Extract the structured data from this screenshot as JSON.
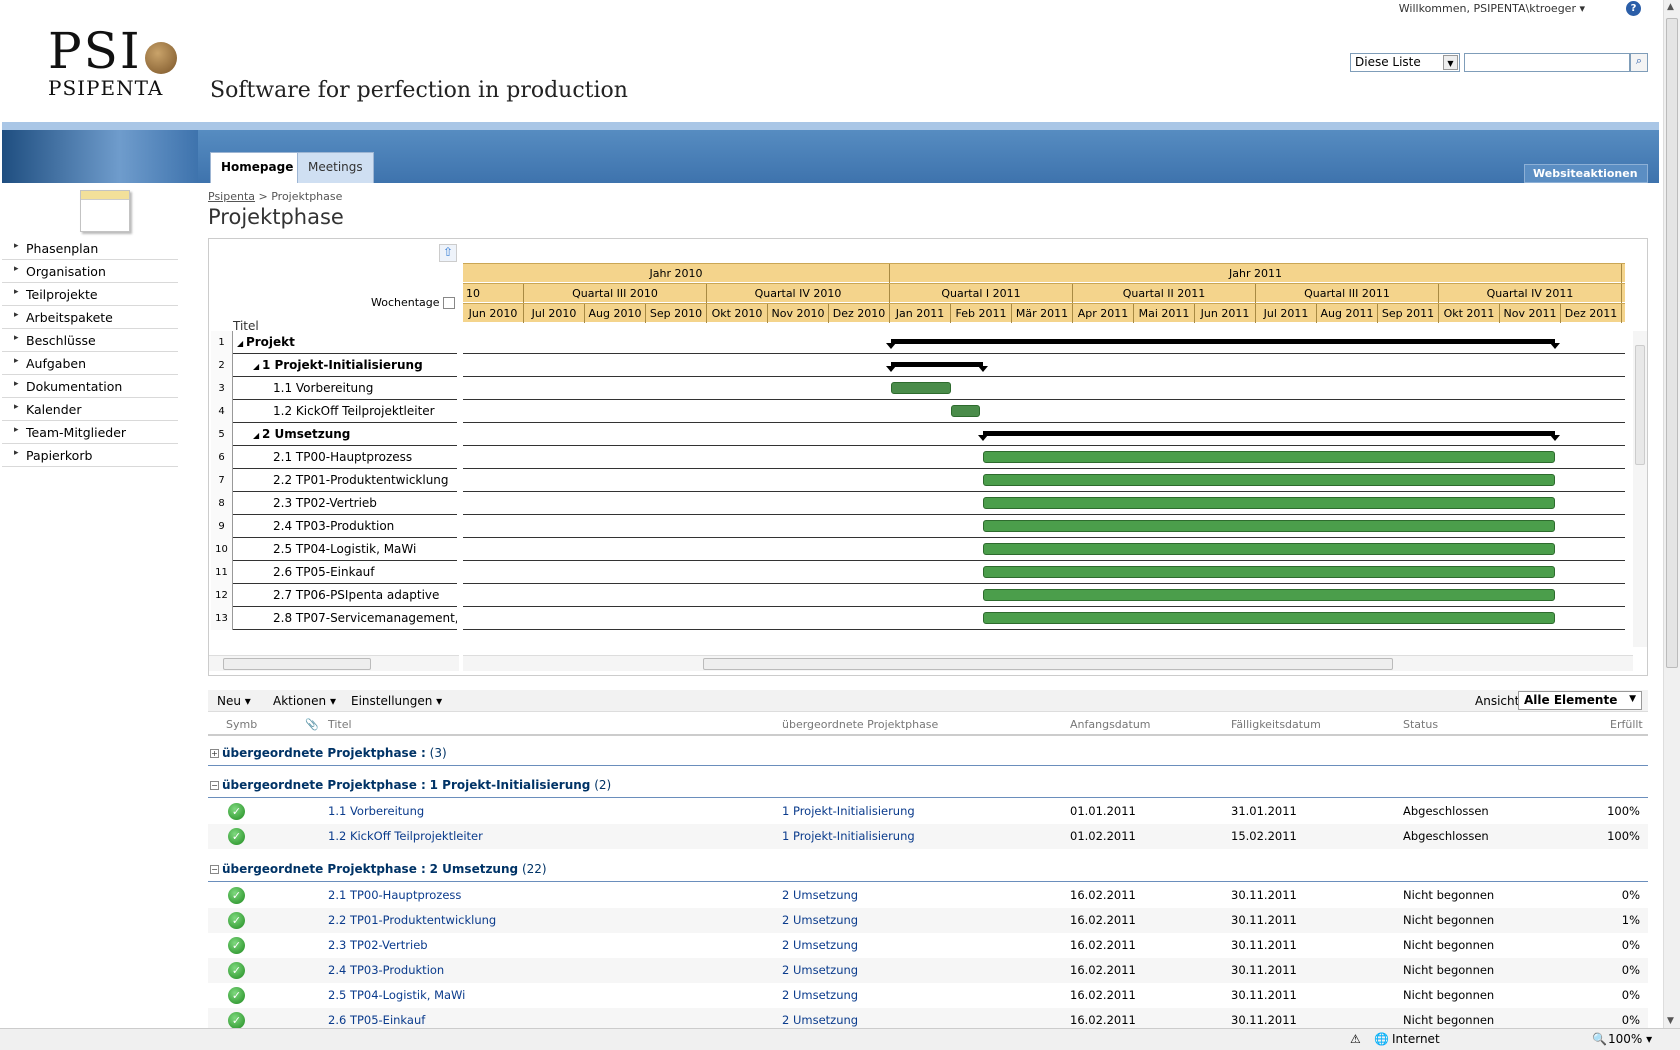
{
  "header": {
    "welcome": "Willkommen, PSIPENTA\\ktroeger ▾",
    "help": "?",
    "logo_main": "PSI",
    "logo_sub": "PSIPENTA",
    "tagline": "Software for perfection in production",
    "search_scope": "Diese Liste",
    "search_placeholder": ""
  },
  "tabs": [
    {
      "label": "Homepage",
      "active": true
    },
    {
      "label": "Meetings",
      "active": false
    }
  ],
  "site_actions": "Websiteaktionen ▾",
  "sidebar": {
    "items": [
      {
        "label": "Phasenplan"
      },
      {
        "label": "Organisation"
      },
      {
        "label": "Teilprojekte"
      },
      {
        "label": "Arbeitspakete"
      },
      {
        "label": "Beschlüsse"
      },
      {
        "label": "Aufgaben"
      },
      {
        "label": "Dokumentation"
      },
      {
        "label": "Kalender"
      },
      {
        "label": "Team-Mitglieder"
      },
      {
        "label": "Papierkorb"
      }
    ]
  },
  "breadcrumb": {
    "root": "Psipenta",
    "sep": " > ",
    "current": "Projektphase"
  },
  "page_title": "Projektphase",
  "gantt": {
    "wochentage": "Wochentage",
    "title_col": "Titel",
    "years": [
      "Jahr 2010",
      "Jahr 2011"
    ],
    "year_fragment": "10",
    "quarters": [
      "Quartal III 2010",
      "Quartal IV 2010",
      "Quartal I 2011",
      "Quartal II 2011",
      "Quartal III 2011",
      "Quartal IV 2011"
    ],
    "months": [
      "Jun 2010",
      "Jul 2010",
      "Aug 2010",
      "Sep 2010",
      "Okt 2010",
      "Nov 2010",
      "Dez 2010",
      "Jan 2011",
      "Feb 2011",
      "Mär 2011",
      "Apr 2011",
      "Mai 2011",
      "Jun 2011",
      "Jul 2011",
      "Aug 2011",
      "Sep 2011",
      "Okt 2011",
      "Nov 2011",
      "Dez 2011"
    ],
    "rows": [
      {
        "num": "1",
        "title": "Projekt",
        "level": 0,
        "summary": true
      },
      {
        "num": "2",
        "title": "1 Projekt-Initialisierung",
        "level": 1,
        "summary": true
      },
      {
        "num": "3",
        "title": "1.1 Vorbereitung",
        "level": 2,
        "summary": false
      },
      {
        "num": "4",
        "title": "1.2 KickOff Teilprojektleiter",
        "level": 2,
        "summary": false
      },
      {
        "num": "5",
        "title": "2 Umsetzung",
        "level": 1,
        "summary": true
      },
      {
        "num": "6",
        "title": "2.1 TP00-Hauptprozess",
        "level": 2,
        "summary": false
      },
      {
        "num": "7",
        "title": "2.2 TP01-Produktentwicklung",
        "level": 2,
        "summary": false
      },
      {
        "num": "8",
        "title": "2.3 TP02-Vertrieb",
        "level": 2,
        "summary": false
      },
      {
        "num": "9",
        "title": "2.4 TP03-Produktion",
        "level": 2,
        "summary": false
      },
      {
        "num": "10",
        "title": "2.5 TP04-Logistik, MaWi",
        "level": 2,
        "summary": false
      },
      {
        "num": "11",
        "title": "2.6 TP05-Einkauf",
        "level": 2,
        "summary": false
      },
      {
        "num": "12",
        "title": "2.7 TP06-PSIpenta adaptive",
        "level": 2,
        "summary": false
      },
      {
        "num": "13",
        "title": "2.8 TP07-Servicemanagement,",
        "level": 2,
        "summary": false
      }
    ]
  },
  "toolbar": {
    "new": "Neu ▾",
    "actions": "Aktionen ▾",
    "settings": "Einstellungen ▾",
    "view_label": "Ansicht:",
    "view_value": "Alle Elemente"
  },
  "list": {
    "columns": [
      "Symb",
      "Titel",
      "übergeordnete Projektphase",
      "Anfangsdatum",
      "Fälligkeitsdatum",
      "Status",
      "Erfüllt"
    ],
    "groups": [
      {
        "toggle": "+",
        "label": "übergeordnete Projektphase :",
        "value": "",
        "count": "(3)"
      },
      {
        "toggle": "−",
        "label": "übergeordnete Projektphase :",
        "value": "1 Projekt-Initialisierung",
        "count": "(2)"
      },
      {
        "toggle": "−",
        "label": "übergeordnete Projektphase :",
        "value": "2 Umsetzung",
        "count": "(22)"
      }
    ],
    "rows": [
      {
        "title": "1.1 Vorbereitung",
        "parent": "1 Projekt-Initialisierung",
        "start": "01.01.2011",
        "due": "31.01.2011",
        "status": "Abgeschlossen",
        "done": "100%"
      },
      {
        "title": "1.2 KickOff Teilprojektleiter",
        "parent": "1 Projekt-Initialisierung",
        "start": "01.02.2011",
        "due": "15.02.2011",
        "status": "Abgeschlossen",
        "done": "100%"
      },
      {
        "title": "2.1 TP00-Hauptprozess",
        "parent": "2 Umsetzung",
        "start": "16.02.2011",
        "due": "30.11.2011",
        "status": "Nicht begonnen",
        "done": "0%"
      },
      {
        "title": "2.2 TP01-Produktentwicklung",
        "parent": "2 Umsetzung",
        "start": "16.02.2011",
        "due": "30.11.2011",
        "status": "Nicht begonnen",
        "done": "1%"
      },
      {
        "title": "2.3 TP02-Vertrieb",
        "parent": "2 Umsetzung",
        "start": "16.02.2011",
        "due": "30.11.2011",
        "status": "Nicht begonnen",
        "done": "0%"
      },
      {
        "title": "2.4 TP03-Produktion",
        "parent": "2 Umsetzung",
        "start": "16.02.2011",
        "due": "30.11.2011",
        "status": "Nicht begonnen",
        "done": "0%"
      },
      {
        "title": "2.5 TP04-Logistik, MaWi",
        "parent": "2 Umsetzung",
        "start": "16.02.2011",
        "due": "30.11.2011",
        "status": "Nicht begonnen",
        "done": "0%"
      },
      {
        "title": "2.6 TP05-Einkauf",
        "parent": "2 Umsetzung",
        "start": "16.02.2011",
        "due": "30.11.2011",
        "status": "Nicht begonnen",
        "done": "0%"
      }
    ]
  },
  "statusbar": {
    "zone": "Internet",
    "zoom": "100% ▾"
  }
}
